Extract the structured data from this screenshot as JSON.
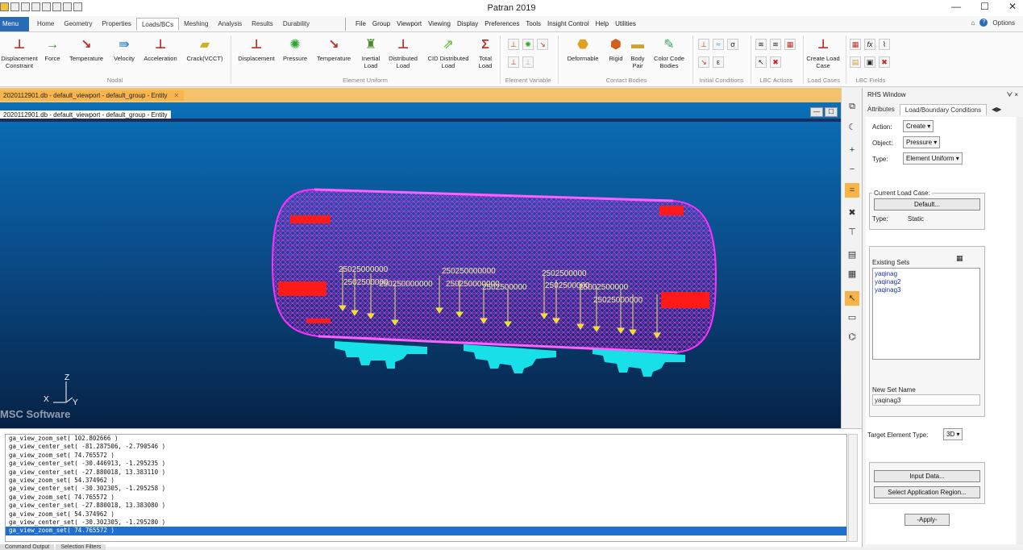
{
  "app": {
    "title": "Patran 2019"
  },
  "window_controls": {
    "minimize": "—",
    "maximize": "☐",
    "close": "✕"
  },
  "menu_button": "Menu",
  "tabs": [
    "Home",
    "Geometry",
    "Properties",
    "Loads/BCs",
    "Meshing",
    "Analysis",
    "Results",
    "Durability"
  ],
  "active_tab": "Loads/BCs",
  "main_menu": [
    "File",
    "Group",
    "Viewport",
    "Viewing",
    "Display",
    "Preferences",
    "Tools",
    "Insight Control",
    "Help",
    "Utilities"
  ],
  "options_label": "Options",
  "ribbon": {
    "nodal": {
      "label": "Nodal",
      "buttons": [
        "Displacement Constraint",
        "Force",
        "Temperature",
        "Velocity",
        "Acceleration",
        "Crack(VCCT)"
      ]
    },
    "element_uniform": {
      "label": "Element Uniform",
      "buttons": [
        "Displacement",
        "Pressure",
        "Temperature",
        "Inertial Load",
        "Distributed Load",
        "CID Distributed Load",
        "Total Load"
      ]
    },
    "element_variable": {
      "label": "Element Variable"
    },
    "contact_bodies": {
      "label": "Contact Bodies",
      "buttons": [
        "Deformable",
        "Rigid",
        "Body Pair",
        "Color Code Bodies"
      ]
    },
    "initial_conditions": {
      "label": "Initial Conditions",
      "symbols": [
        "σ",
        "ε"
      ]
    },
    "lbc_actions": {
      "label": "LBC Actions"
    },
    "load_cases": {
      "label": "Load Cases",
      "buttons": [
        "Create Load Case"
      ]
    },
    "lbc_fields": {
      "label": "LBC Fields",
      "symbols": [
        "fx"
      ]
    }
  },
  "document_tab": {
    "title": "2020112901.db - default_viewport - default_group - Entity"
  },
  "viewport": {
    "header": "2020112901.db - default_viewport - default_group - Entity",
    "axis_z": "Z",
    "axis_x": "X",
    "axis_y": "Y",
    "logo": "MSC Software",
    "load_labels": [
      "25025000000",
      "2502500000",
      "250250000000",
      "250250000000",
      "250250000000",
      "2502500000",
      "2502500000",
      "2502500000",
      "25002500000",
      "25025000000"
    ]
  },
  "rhs": {
    "title": "RHS Window",
    "tabs": [
      "Attributes",
      "Load/Boundary Conditions"
    ],
    "action_label": "Action:",
    "action_value": "Create",
    "object_label": "Object:",
    "object_value": "Pressure",
    "type_label": "Type:",
    "type_value": "Element Uniform",
    "current_load_case_label": "Current Load Case:",
    "load_case_button": "Default...",
    "lc_type_label": "Type:",
    "lc_type_value": "Static",
    "existing_sets_label": "Existing Sets",
    "existing_sets": [
      "yaqinag",
      "yaqinag2",
      "yaqinag3"
    ],
    "new_set_name_label": "New Set Name",
    "new_set_name_value": "yaqinag3",
    "target_element_type_label": "Target Element Type:",
    "target_element_type_value": "3D",
    "input_data_button": "Input Data...",
    "select_region_button": "Select Application Region...",
    "apply_button": "-Apply-"
  },
  "command_output": [
    "ga_view_zoom_set( 102.802666 )",
    "ga_view_center_set( -81.287506, -2.790546 )",
    "ga_view_zoom_set( 74.765572 )",
    "ga_view_center_set( -30.446913, -1.295235 )",
    "ga_view_center_set( -27.880018, 13.383110 )",
    "ga_view_zoom_set( 54.374962 )",
    "ga_view_center_set( -30.302305, -1.295258 )",
    "ga_view_zoom_set( 74.765572 )",
    "ga_view_center_set( -27.880018, 13.383080 )",
    "ga_view_zoom_set( 54.374962 )",
    "ga_view_center_set( -30.302305, -1.295280 )",
    "ga_view_zoom_set( 74.765572 )"
  ],
  "bottom_tabs": [
    "Command Output",
    "Selection Filters"
  ]
}
